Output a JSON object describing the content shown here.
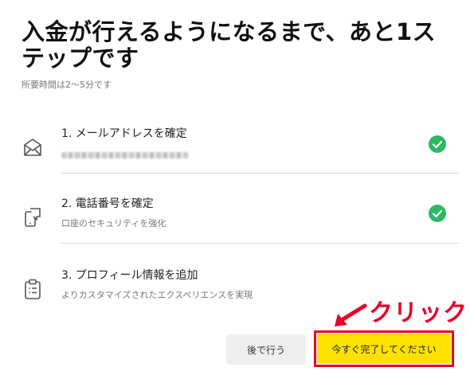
{
  "header": {
    "title": "入金が行えるようになるまで、あと1ステップです",
    "subtitle": "所要時間は2〜5分です"
  },
  "steps": [
    {
      "label": "1. メールアドレスを確定",
      "sub": "",
      "icon": "envelope-icon",
      "status": "completed"
    },
    {
      "label": "2. 電話番号を確定",
      "sub": "口座のセキュリティを強化",
      "icon": "phone-icon",
      "status": "completed"
    },
    {
      "label": "3. プロフィール情報を追加",
      "sub": "よりカスタマイズされたエクスペリエンスを実現",
      "icon": "clipboard-icon",
      "status": "pending"
    }
  ],
  "annotation": {
    "text": "クリック",
    "color": "#e8002a"
  },
  "buttons": {
    "later": "後で行う",
    "complete": "今すぐ完了してください"
  },
  "colors": {
    "check": "#2db963",
    "primary": "#fde200",
    "annotation": "#e8002a"
  }
}
